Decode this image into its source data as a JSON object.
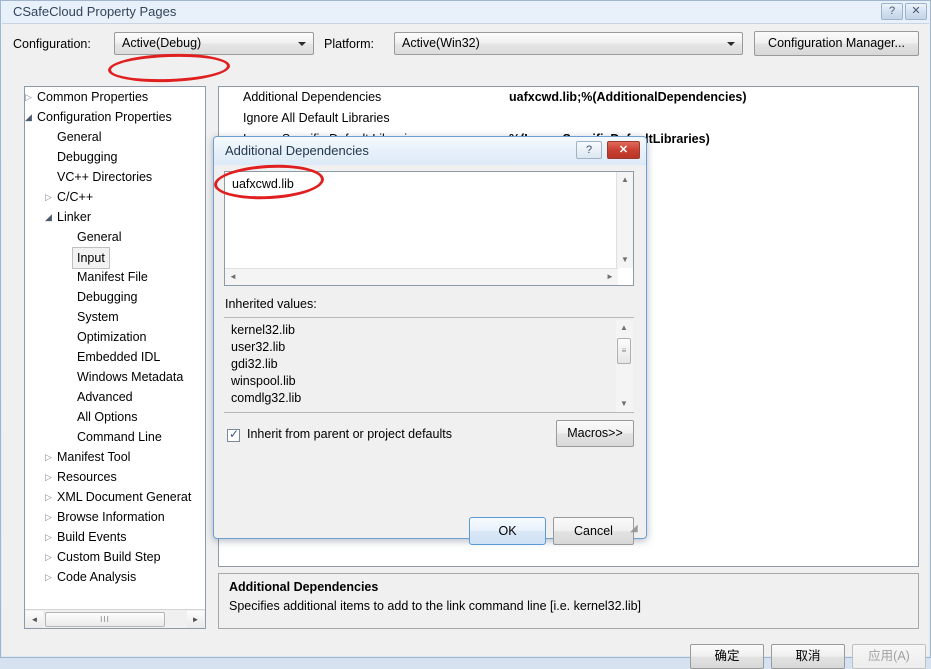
{
  "window": {
    "title": "CSafeCloud Property Pages",
    "help_icon": "?",
    "close_icon": "✕"
  },
  "config_row": {
    "configuration_label": "Configuration:",
    "configuration_value": "Active(Debug)",
    "platform_label": "Platform:",
    "platform_value": "Active(Win32)",
    "configuration_manager_button": "Configuration Manager..."
  },
  "tree": {
    "items": [
      {
        "label": "Common Properties",
        "indent": 0,
        "arrow": "collapsed",
        "selected": false
      },
      {
        "label": "Configuration Properties",
        "indent": 0,
        "arrow": "expanded",
        "selected": false
      },
      {
        "label": "General",
        "indent": 1,
        "arrow": "none",
        "selected": false
      },
      {
        "label": "Debugging",
        "indent": 1,
        "arrow": "none",
        "selected": false
      },
      {
        "label": "VC++ Directories",
        "indent": 1,
        "arrow": "none",
        "selected": false
      },
      {
        "label": "C/C++",
        "indent": 1,
        "arrow": "collapsed",
        "selected": false
      },
      {
        "label": "Linker",
        "indent": 1,
        "arrow": "expanded",
        "selected": false
      },
      {
        "label": "General",
        "indent": 2,
        "arrow": "none",
        "selected": false
      },
      {
        "label": "Input",
        "indent": 2,
        "arrow": "none",
        "selected": true
      },
      {
        "label": "Manifest File",
        "indent": 2,
        "arrow": "none",
        "selected": false
      },
      {
        "label": "Debugging",
        "indent": 2,
        "arrow": "none",
        "selected": false
      },
      {
        "label": "System",
        "indent": 2,
        "arrow": "none",
        "selected": false
      },
      {
        "label": "Optimization",
        "indent": 2,
        "arrow": "none",
        "selected": false
      },
      {
        "label": "Embedded IDL",
        "indent": 2,
        "arrow": "none",
        "selected": false
      },
      {
        "label": "Windows Metadata",
        "indent": 2,
        "arrow": "none",
        "selected": false
      },
      {
        "label": "Advanced",
        "indent": 2,
        "arrow": "none",
        "selected": false
      },
      {
        "label": "All Options",
        "indent": 2,
        "arrow": "none",
        "selected": false
      },
      {
        "label": "Command Line",
        "indent": 2,
        "arrow": "none",
        "selected": false
      },
      {
        "label": "Manifest Tool",
        "indent": 1,
        "arrow": "collapsed",
        "selected": false
      },
      {
        "label": "Resources",
        "indent": 1,
        "arrow": "collapsed",
        "selected": false
      },
      {
        "label": "XML Document Generat",
        "indent": 1,
        "arrow": "collapsed",
        "selected": false
      },
      {
        "label": "Browse Information",
        "indent": 1,
        "arrow": "collapsed",
        "selected": false
      },
      {
        "label": "Build Events",
        "indent": 1,
        "arrow": "collapsed",
        "selected": false
      },
      {
        "label": "Custom Build Step",
        "indent": 1,
        "arrow": "collapsed",
        "selected": false
      },
      {
        "label": "Code Analysis",
        "indent": 1,
        "arrow": "collapsed",
        "selected": false
      }
    ],
    "hscroll": {
      "left_arrow": "◄",
      "right_arrow": "►",
      "thumb_grip": "III"
    }
  },
  "property_grid": {
    "rows": [
      {
        "name": "Additional Dependencies",
        "value": "uafxcwd.lib;%(AdditionalDependencies)"
      },
      {
        "name": "Ignore All Default Libraries",
        "value": ""
      },
      {
        "name": "Ignore Specific Default Libraries",
        "value": "%(IgnoreSpecificDefaultLibraries)"
      }
    ]
  },
  "description": {
    "title": "Additional Dependencies",
    "body": "Specifies additional items to add to the link command line [i.e. kernel32.lib]"
  },
  "bottom_buttons": {
    "ok": "确定",
    "cancel": "取消",
    "apply": "应用(A)"
  },
  "dialog": {
    "title": "Additional Dependencies",
    "help_icon": "?",
    "close_icon": "✕",
    "edit_value": "uafxcwd.lib",
    "inherited_label": "Inherited values:",
    "inherited_values": [
      "kernel32.lib",
      "user32.lib",
      "gdi32.lib",
      "winspool.lib",
      "comdlg32.lib"
    ],
    "inherit_checkbox_label": "Inherit from parent or project defaults",
    "inherit_checkbox_checked": true,
    "inherit_check_mark": "✓",
    "macros_button": "Macros>>",
    "ok_button": "OK",
    "cancel_button": "Cancel",
    "scroll_up_icon": "▲",
    "scroll_down_icon": "▼",
    "scroll_left_icon": "◄",
    "scroll_right_icon": "►",
    "resize_grip_icon": "◢",
    "thumb_grip": "≡"
  },
  "annotations": {
    "accent_color": "#e02020",
    "targets": [
      "Active(Debug)",
      "uafxcwd.lib"
    ]
  }
}
